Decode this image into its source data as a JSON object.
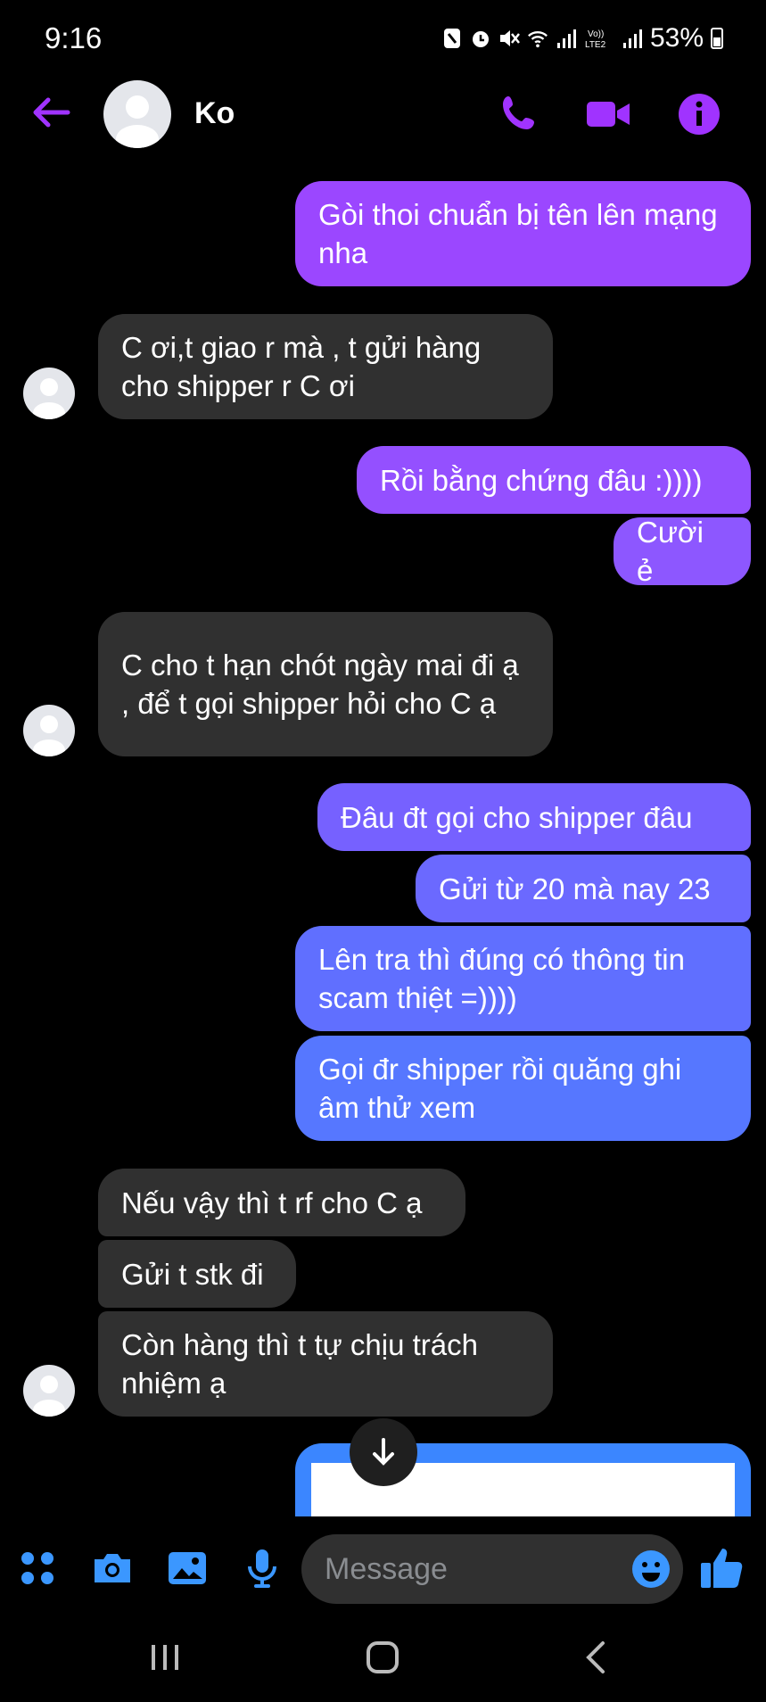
{
  "status_bar": {
    "time": "9:16",
    "battery": "53%"
  },
  "header": {
    "contact_name": "Ko"
  },
  "messages": [
    {
      "dir": "out",
      "text": "Gòi thoi chuẩn bị tên lên mạng nha"
    },
    {
      "dir": "in",
      "text": "C ơi,t giao r mà , t gửi hàng cho shipper r C ơi"
    },
    {
      "dir": "out",
      "text": "Rồi bằng chứng đâu :))))"
    },
    {
      "dir": "out",
      "text": "Cười ẻ"
    },
    {
      "dir": "in",
      "text": "C cho t hạn chót ngày mai đi ạ , để t gọi shipper hỏi cho C ạ"
    },
    {
      "dir": "out",
      "text": "Đâu đt gọi cho shipper đâu"
    },
    {
      "dir": "out",
      "text": "Gửi từ 20 mà nay 23"
    },
    {
      "dir": "out",
      "text": "Lên tra thì đúng có thông tin scam thiệt =))))"
    },
    {
      "dir": "out",
      "text": "Gọi đr shipper rồi quăng ghi âm thử xem"
    },
    {
      "dir": "in",
      "text": "Nếu vậy thì t rf cho C ạ"
    },
    {
      "dir": "in",
      "text": "Gửi t stk đi"
    },
    {
      "dir": "in",
      "text": "Còn hàng thì t tự chịu trách nhiệm ạ"
    }
  ],
  "composer": {
    "placeholder": "Message"
  },
  "colors": {
    "accent": "#a033ff",
    "incoming": "#303030",
    "outgoing_top": "#9b47ff",
    "outgoing_bottom": "#4f7bff",
    "composer_icon": "#3b97ff"
  },
  "icons": [
    "back-arrow-icon",
    "phone-icon",
    "video-icon",
    "info-icon",
    "menu-dots-icon",
    "camera-icon",
    "gallery-icon",
    "mic-icon",
    "emoji-icon",
    "thumbs-up-icon",
    "scroll-down-icon"
  ]
}
